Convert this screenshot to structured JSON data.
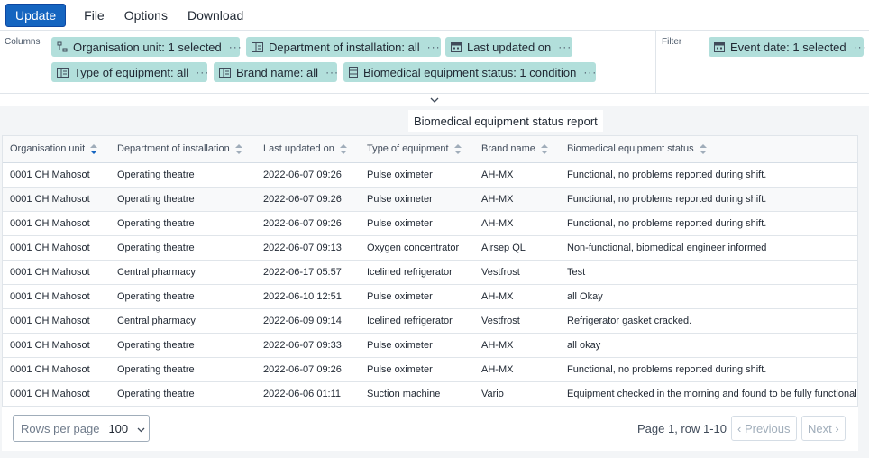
{
  "menu": {
    "update_label": "Update",
    "file_label": "File",
    "options_label": "Options",
    "download_label": "Download"
  },
  "layout": {
    "columns_label": "Columns",
    "filter_label": "Filter",
    "column_chips": [
      {
        "label": "Organisation unit: 1 selected",
        "icon": "org-unit-icon"
      },
      {
        "label": "Department of installation: all",
        "icon": "dimension-icon"
      },
      {
        "label": "Last updated on",
        "icon": "calendar-icon"
      },
      {
        "label": "Type of equipment: all",
        "icon": "dimension-icon"
      },
      {
        "label": "Brand name: all",
        "icon": "dimension-icon"
      },
      {
        "label": "Biomedical equipment status: 1 condition",
        "icon": "data-element-icon"
      }
    ],
    "filter_chips": [
      {
        "label": "Event date: 1 selected",
        "icon": "calendar-icon"
      }
    ],
    "chip_menu_glyph": "···"
  },
  "report": {
    "title": "Biomedical equipment status report",
    "columns": [
      "Organisation unit",
      "Department of installation",
      "Last updated on",
      "Type of equipment",
      "Brand name",
      "Biomedical equipment status"
    ],
    "rows": [
      [
        "0001 CH Mahosot",
        "Operating theatre",
        "2022-06-07 09:26",
        "Pulse oximeter",
        "AH-MX",
        "Functional, no problems reported during shift."
      ],
      [
        "0001 CH Mahosot",
        "Operating theatre",
        "2022-06-07 09:26",
        "Pulse oximeter",
        "AH-MX",
        "Functional, no problems reported during shift."
      ],
      [
        "0001 CH Mahosot",
        "Operating theatre",
        "2022-06-07 09:26",
        "Pulse oximeter",
        "AH-MX",
        "Functional, no problems reported during shift."
      ],
      [
        "0001 CH Mahosot",
        "Operating theatre",
        "2022-06-07 09:13",
        "Oxygen concentrator",
        "Airsep QL",
        "Non-functional, biomedical engineer informed"
      ],
      [
        "0001 CH Mahosot",
        "Central pharmacy",
        "2022-06-17 05:57",
        "Icelined refrigerator",
        "Vestfrost",
        "Test"
      ],
      [
        "0001 CH Mahosot",
        "Operating theatre",
        "2022-06-10 12:51",
        "Pulse oximeter",
        "AH-MX",
        "all Okay"
      ],
      [
        "0001 CH Mahosot",
        "Central pharmacy",
        "2022-06-09 09:14",
        "Icelined refrigerator",
        "Vestfrost",
        "Refrigerator gasket cracked."
      ],
      [
        "0001 CH Mahosot",
        "Operating theatre",
        "2022-06-07 09:33",
        "Pulse oximeter",
        "AH-MX",
        "all okay"
      ],
      [
        "0001 CH Mahosot",
        "Operating theatre",
        "2022-06-07 09:26",
        "Pulse oximeter",
        "AH-MX",
        "Functional, no problems reported during shift."
      ],
      [
        "0001 CH Mahosot",
        "Operating theatre",
        "2022-06-06 01:11",
        "Suction machine",
        "Vario",
        "Equipment checked in the morning and found to be fully functional"
      ]
    ]
  },
  "pagination": {
    "rows_per_page_label": "Rows per page",
    "rows_per_page_value": "100",
    "page_info": "Page 1, row 1-10",
    "previous_label": "‹ Previous",
    "next_label": "Next ›"
  },
  "colors": {
    "accent": "#1565c0",
    "chip": "#b2dfdb",
    "sort_active": "#1565c0"
  }
}
